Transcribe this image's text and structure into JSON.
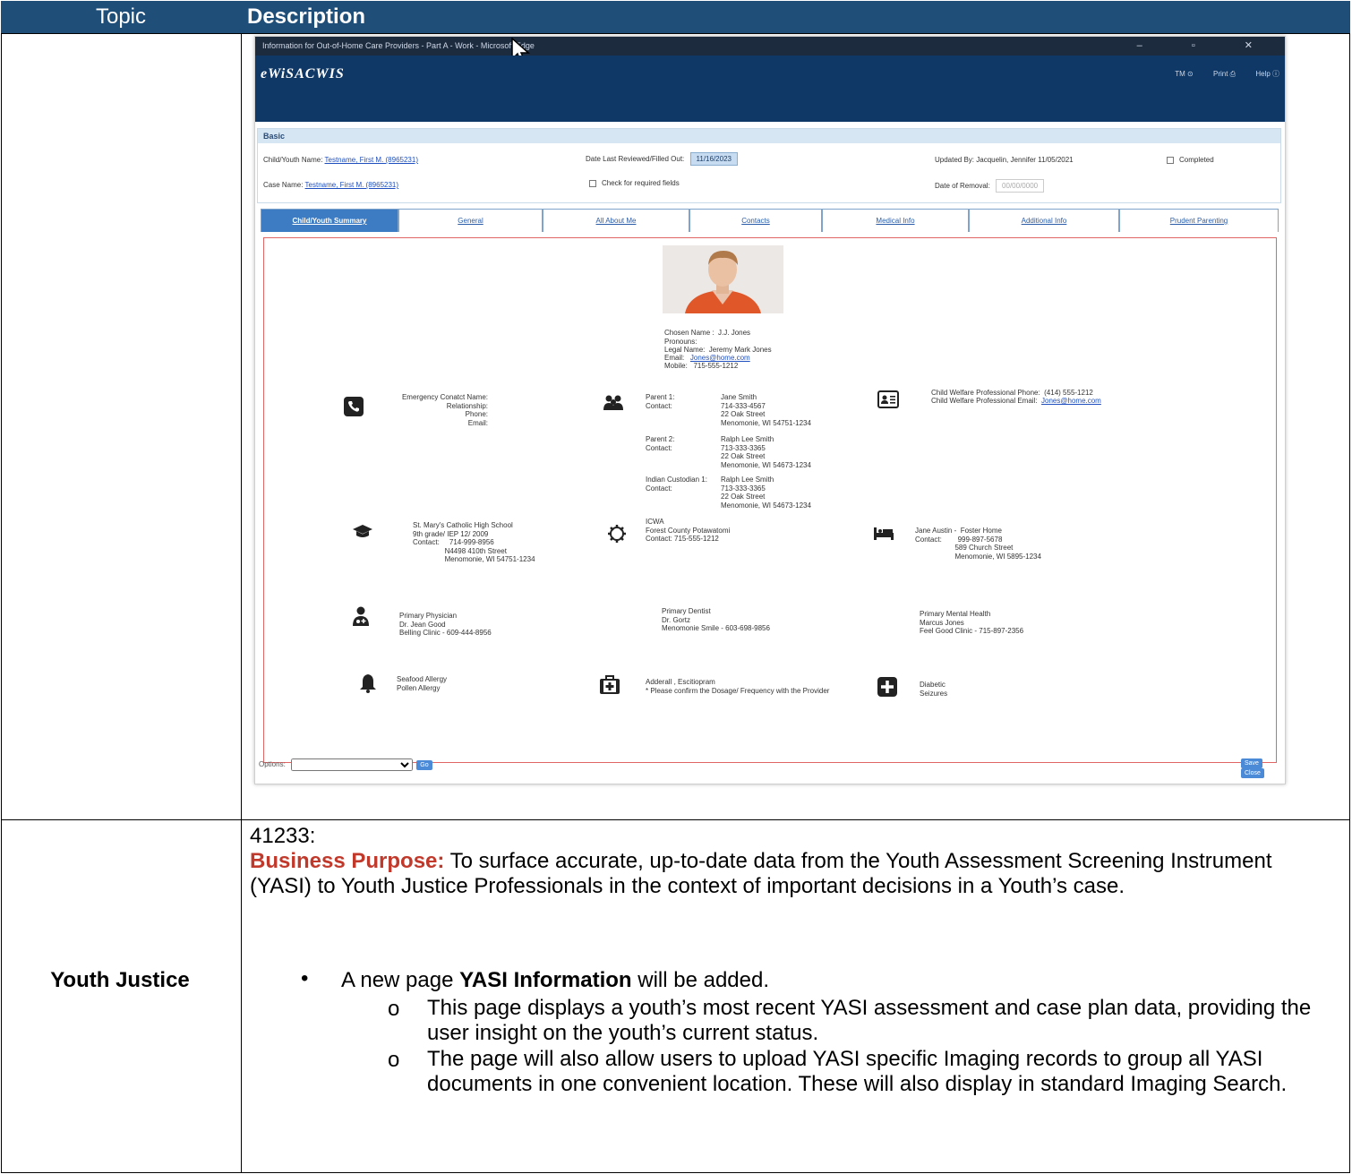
{
  "table": {
    "header_topic": "Topic",
    "header_description": "Description"
  },
  "screenshot": {
    "window_title": "Information for Out-of-Home Care Providers - Part A - Work - Microsoft Edge",
    "brand": "eWiSACWIS",
    "top_links": [
      "TM",
      "Print",
      "Help"
    ],
    "basic": {
      "section_title": "Basic",
      "child_label": "Child/Youth Name:",
      "child_value": "Testname, First M. (8965231)",
      "date_label": "Date Last Reviewed/Filled Out:",
      "date_value": "11/16/2023",
      "updated_label": "Updated By: Jacquelin, Jennifer  11/05/2021",
      "completed_label": "Completed",
      "case_label": "Case Name:",
      "case_value": "Testname, First M. (8965231)",
      "check_required_label": "Check for required fields",
      "removal_label": "Date of Removal:",
      "removal_placeholder": "00/00/0000"
    },
    "tabs": [
      "Child/Youth Summary",
      "General",
      "All About Me",
      "Contacts",
      "Medical Info",
      "Additional Info",
      "Prudent Parenting"
    ],
    "profile": {
      "chosen": "Chosen Name :  J.J. Jones",
      "pronouns": "Pronouns:",
      "legal": "Legal Name:  Jeremy Mark Jones",
      "email_label": "Email:",
      "email": "Jones@home.com",
      "mobile": "Mobile:   715-555-1212"
    },
    "emergency": {
      "labels": "Emergency Conatct Name:\nRelationship:\nPhone:\nEmail:"
    },
    "parents": {
      "p1_labels": "Parent 1:\nContact:",
      "p1_values": "Jane Smith\n714-333-4567\n22 Oak Street\nMenomonie, WI 54751-1234",
      "p2_labels": "Parent 2:\nContact:",
      "p2_values": "Ralph Lee Smith\n713-333-3365\n22 Oak Street\nMenomonie, WI 54673-1234",
      "ic_labels": "Indian Custodian 1:\nContact:",
      "ic_values": "Ralph Lee Smith\n713-333-3365\n22 Oak Street\nMenomonie, WI 54673-1234"
    },
    "cwp": {
      "phone": "Child Welfare Professional Phone:  (414) 555-1212",
      "email_label": "Child Welfare Professional Email:",
      "email": "Jones@home.com"
    },
    "school": "St. Mary's Catholic High School\n9th grade/ IEP 12/ 2009\nContact:     714-999-8956\n                N4498 410th Street\n                Menomonie, WI 54751-1234",
    "icwa": "ICWA\nForest County Potawatomi\nContact: 715-555-1212",
    "placement": "Jane Austin -  Foster Home\nContact:        999-897-5678\n                    589 Church Street\n                    Menomonie, WI 5895-1234",
    "physician": "Primary Physician\nDr. Jean Good\nBelling Clinic - 609-444-8956",
    "dentist": "Primary Dentist\nDr. Gortz\nMenomonie Smile - 603-698-9856",
    "mental": "Primary Mental Health\nMarcus Jones\nFeel Good Clinic - 715-897-2356",
    "allergies": "Seafood Allergy\nPollen Allergy",
    "medications": "Adderall , Escitiopram\n* Please confirm the Dosage/ Frequency with the Provider",
    "conditions": "Diabetic\nSeizures",
    "options_label": "Options:",
    "go_label": "Go",
    "save_label": "Save",
    "close_label": "Close"
  },
  "youth_justice": {
    "topic": "Youth Justice",
    "id": "41233:",
    "bp_label": "Business Purpose:",
    "bp_text": " To surface accurate, up-to-date data from the Youth Assessment Screening Instrument (YASI) to Youth Justice Professionals in the context of important decisions in a Youth’s case.",
    "bullet_pre": "A new page ",
    "bullet_bold": "YASI Information",
    "bullet_post": " will be added.",
    "sub1": "This page displays a youth’s most recent YASI assessment and case plan data, providing the user insight on the youth’s current status.",
    "sub2": "The page will also allow users to upload YASI specific Imaging records to group all YASI documents in one convenient location. These will also display in standard Imaging Search."
  }
}
